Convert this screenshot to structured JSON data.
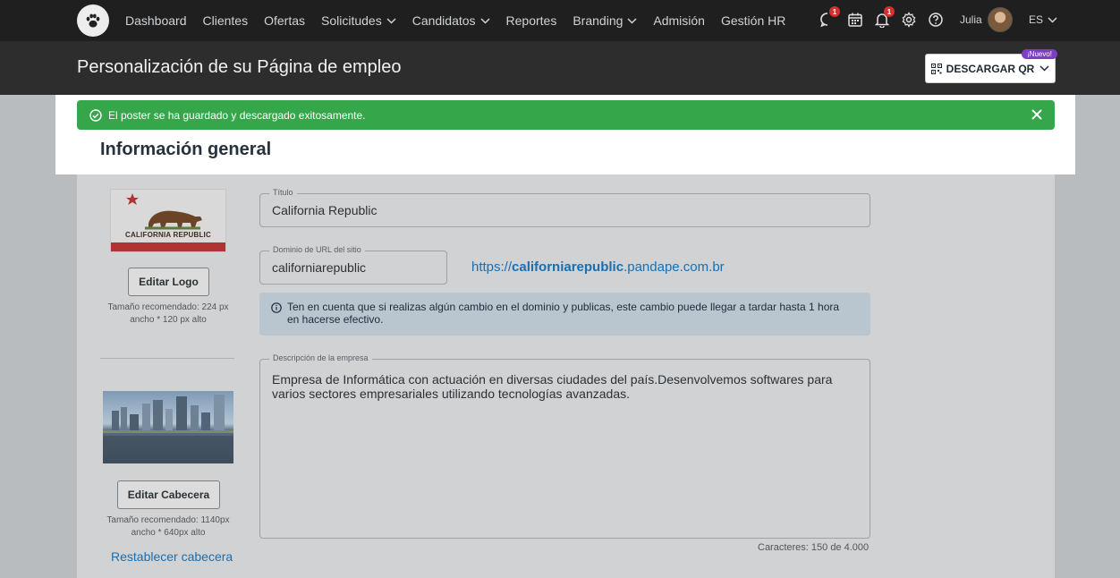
{
  "nav": {
    "items": [
      {
        "label": "Dashboard",
        "dropdown": false
      },
      {
        "label": "Clientes",
        "dropdown": false
      },
      {
        "label": "Ofertas",
        "dropdown": false
      },
      {
        "label": "Solicitudes",
        "dropdown": true
      },
      {
        "label": "Candidatos",
        "dropdown": true
      },
      {
        "label": "Reportes",
        "dropdown": false
      },
      {
        "label": "Branding",
        "dropdown": true
      },
      {
        "label": "Admisión",
        "dropdown": false
      },
      {
        "label": "Gestión HR",
        "dropdown": false
      }
    ],
    "icons": {
      "chat": {
        "name": "chat-icon",
        "badge": "1"
      },
      "calendar": {
        "name": "calendar-icon"
      },
      "bell": {
        "name": "bell-icon",
        "badge": "1"
      },
      "settings": {
        "name": "gear-icon"
      },
      "help": {
        "name": "help-icon"
      }
    },
    "user_name": "Julia",
    "language": "ES"
  },
  "header": {
    "title": "Personalización de su Página de empleo",
    "qr_button": "DESCARGAR QR",
    "new_badge": "¡Nuevo!"
  },
  "toast": {
    "message": "El poster se ha guardado y descargado exitosamente.",
    "color": "#36a64a"
  },
  "section": {
    "title": "Información general"
  },
  "logo_panel": {
    "flag_text": "CALIFORNIA REPUBLIC",
    "edit_button": "Editar Logo",
    "hint_line1": "Tamaño recomendado: 224 px",
    "hint_line2": "ancho * 120 px alto"
  },
  "header_panel": {
    "edit_button": "Editar Cabecera",
    "hint_line1": "Tamaño recomendado: 1140px",
    "hint_line2": "ancho * 640px alto",
    "reset_link": "Restablecer cabecera"
  },
  "form": {
    "title": {
      "label": "Título",
      "value": "California Republic"
    },
    "domain": {
      "label": "Dominio de URL del sitio",
      "value": "californiarepublic"
    },
    "url_preview": {
      "prefix": "https://",
      "domain": "californiarepublic",
      "suffix": ".pandape.com.br"
    },
    "info": "Ten en cuenta que si realizas algún cambio en el dominio y publicas, este cambio puede llegar a tardar hasta 1 hora en hacerse efectivo.",
    "description": {
      "label": "Descripción de la empresa",
      "value": "Empresa de Informática con actuación en diversas ciudades del país.Desenvolvemos softwares para varios sectores empresariales utilizando tecnologías avanzadas."
    },
    "char_count": "Caracteres: 150 de 4.000"
  }
}
